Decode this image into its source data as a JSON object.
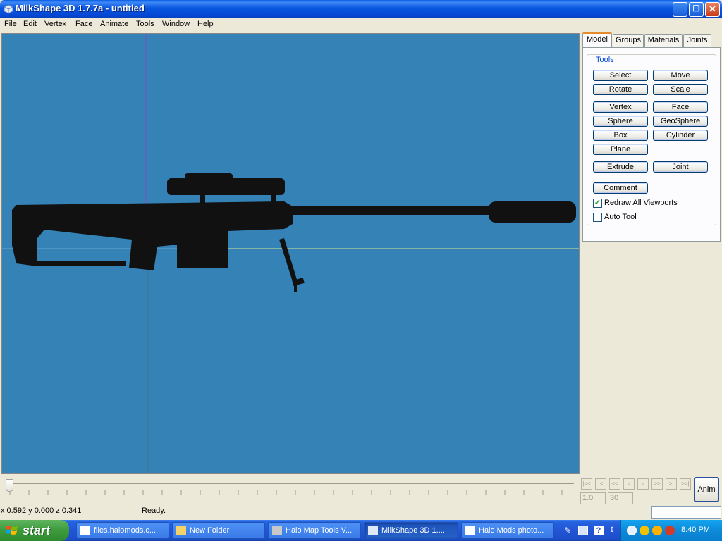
{
  "window": {
    "title": "MilkShape 3D 1.7.7a - untitled",
    "controls": {
      "minimize": "_",
      "maximize": "❐",
      "close": "✕"
    }
  },
  "menu": [
    "File",
    "Edit",
    "Vertex",
    "Face",
    "Animate",
    "Tools",
    "Window",
    "Help"
  ],
  "tabs": [
    "Model",
    "Groups",
    "Materials",
    "Joints"
  ],
  "tools": {
    "group_label": "Tools",
    "buttons": [
      "Select",
      "Move",
      "Rotate",
      "Scale",
      "Vertex",
      "Face",
      "Sphere",
      "GeoSphere",
      "Box",
      "Cylinder",
      "Plane",
      "Extrude",
      "Joint",
      "Comment"
    ],
    "checkboxes": [
      {
        "label": "Redraw All Viewports",
        "checked": true
      },
      {
        "label": "Auto Tool",
        "checked": false
      }
    ]
  },
  "viewport": {
    "background": "#3482b6",
    "model_color": "#111111"
  },
  "timeline": {
    "nav_buttons": [
      "|<<",
      "|<",
      "<<",
      "<",
      ">",
      ">>",
      ">|",
      ">>|"
    ],
    "start_frame": "1.0",
    "end_frame": "30",
    "anim_label": "Anim"
  },
  "status": {
    "coordinates": "x 0.592 y 0.000 z 0.341",
    "message": "Ready."
  },
  "taskbar": {
    "start_label": "start",
    "items": [
      {
        "label": "files.halomods.c..."
      },
      {
        "label": "New Folder"
      },
      {
        "label": "Halo Map Tools V..."
      },
      {
        "label": "MilkShape 3D 1....",
        "active": true
      },
      {
        "label": "Halo Mods photo..."
      }
    ],
    "clock": "8:40 PM"
  }
}
